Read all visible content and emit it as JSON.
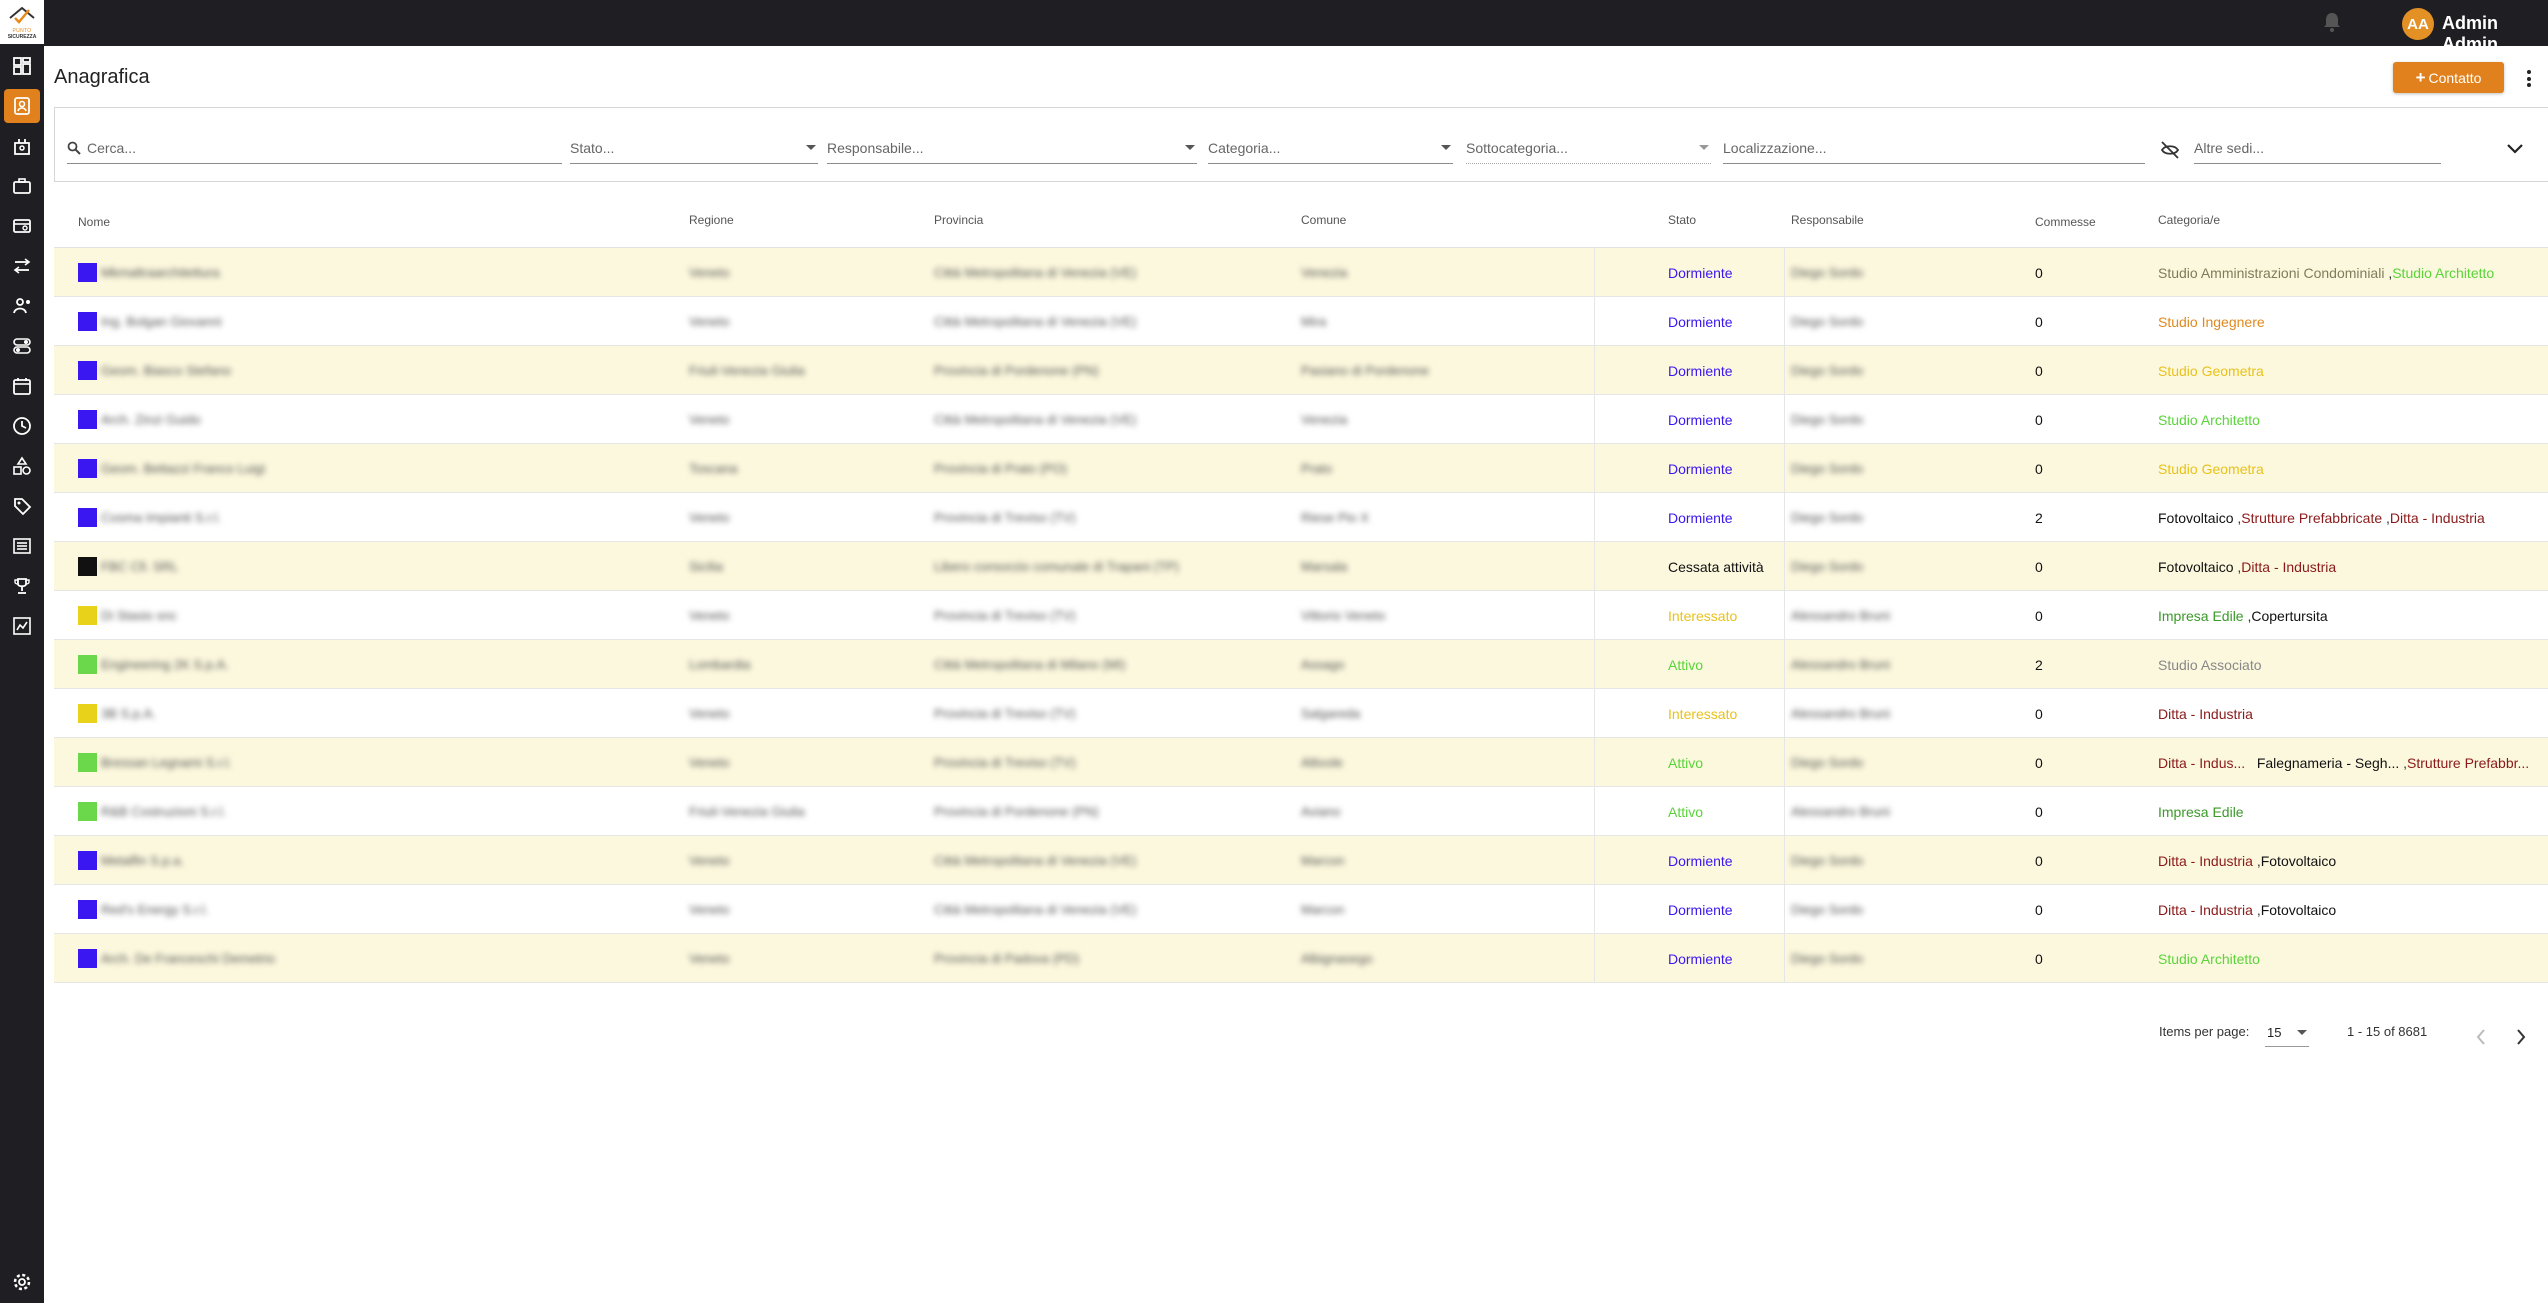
{
  "app": {
    "logo_text_1": "PUNTO",
    "logo_text_2": "SICUREZZA",
    "user_initials": "AA",
    "user_name": "Admin Admin"
  },
  "sidebar": {
    "items": [
      {
        "icon": "dashboard-icon",
        "active": false
      },
      {
        "icon": "contacts-icon",
        "active": true
      },
      {
        "icon": "company-icon",
        "active": false
      },
      {
        "icon": "briefcase-icon",
        "active": false
      },
      {
        "icon": "billing-icon",
        "active": false
      },
      {
        "icon": "transfer-icon",
        "active": false
      },
      {
        "icon": "user-manage-icon",
        "active": false
      },
      {
        "icon": "toggles-icon",
        "active": false
      },
      {
        "icon": "calendar-icon",
        "active": false
      },
      {
        "icon": "clock-icon",
        "active": false
      },
      {
        "icon": "shapes-icon",
        "active": false
      },
      {
        "icon": "tag-icon",
        "active": false
      },
      {
        "icon": "list-icon",
        "active": false
      },
      {
        "icon": "trophy-icon",
        "active": false
      },
      {
        "icon": "chart-icon",
        "active": false
      },
      {
        "icon": "settings-icon",
        "active": false
      }
    ]
  },
  "header": {
    "title": "Anagrafica",
    "add_label": "Contatto"
  },
  "filters": {
    "search_placeholder": "Cerca...",
    "stato_placeholder": "Stato...",
    "responsabile_placeholder": "Responsabile...",
    "categoria_placeholder": "Categoria...",
    "sottocategoria_placeholder": "Sottocategoria...",
    "localizzazione_placeholder": "Localizzazione...",
    "altre_sedi_placeholder": "Altre sedi..."
  },
  "table": {
    "columns": {
      "nome": "Nome",
      "regione": "Regione",
      "provincia": "Provincia",
      "comune": "Comune",
      "stato": "Stato",
      "responsabile": "Responsabile",
      "commesse": "Commesse",
      "categorie": "Categoria/e"
    },
    "rows": [
      {
        "color": "#3a16f0",
        "nome": "Mkmaltraarchitettura",
        "regione": "Veneto",
        "provincia": "Città Metropolitana di Venezia (VE)",
        "comune": "Venezia",
        "stato": "Dormiente",
        "stato_color": "#3a16f0",
        "responsabile": "Diego Sordo",
        "commesse": "0",
        "categorie": [
          {
            "t": "Studio Amministrazioni Condominiali",
            "c": "#7d7d5a"
          },
          {
            "t": " ,",
            "c": "#333"
          },
          {
            "t": "Studio Architetto",
            "c": "#5ad43a"
          }
        ]
      },
      {
        "color": "#3a16f0",
        "nome": "Ing. Bolgan Giovanni",
        "regione": "Veneto",
        "provincia": "Città Metropolitana di Venezia (VE)",
        "comune": "Mira",
        "stato": "Dormiente",
        "stato_color": "#3a16f0",
        "responsabile": "Diego Sordo",
        "commesse": "0",
        "categorie": [
          {
            "t": "Studio Ingegnere",
            "c": "#e08a1e"
          }
        ]
      },
      {
        "color": "#3a16f0",
        "nome": "Geom. Biasco Stefano",
        "regione": "Friuli-Venezia Giulia",
        "provincia": "Provincia di Pordenone (PN)",
        "comune": "Pasiano di Pordenone",
        "stato": "Dormiente",
        "stato_color": "#3a16f0",
        "responsabile": "Diego Sordo",
        "commesse": "0",
        "categorie": [
          {
            "t": "Studio Geometra",
            "c": "#e8c21a"
          }
        ]
      },
      {
        "color": "#3a16f0",
        "nome": "Arch. Zinzi Guido",
        "regione": "Veneto",
        "provincia": "Città Metropolitana di Venezia (VE)",
        "comune": "Venezia",
        "stato": "Dormiente",
        "stato_color": "#3a16f0",
        "responsabile": "Diego Sordo",
        "commesse": "0",
        "categorie": [
          {
            "t": "Studio Architetto",
            "c": "#5ad43a"
          }
        ]
      },
      {
        "color": "#3a16f0",
        "nome": "Geom. Bettazzi Franco Luigi",
        "regione": "Toscana",
        "provincia": "Provincia di Prato (PO)",
        "comune": "Prato",
        "stato": "Dormiente",
        "stato_color": "#3a16f0",
        "responsabile": "Diego Sordo",
        "commesse": "0",
        "categorie": [
          {
            "t": "Studio Geometra",
            "c": "#e8c21a"
          }
        ]
      },
      {
        "color": "#3a16f0",
        "nome": "Cosma Impianti S.r.l.",
        "regione": "Veneto",
        "provincia": "Provincia di Treviso (TV)",
        "comune": "Riese Pio X",
        "stato": "Dormiente",
        "stato_color": "#3a16f0",
        "responsabile": "Diego Sordo",
        "commesse": "2",
        "categorie": [
          {
            "t": "Fotovoltaico",
            "c": "#111"
          },
          {
            "t": " ,",
            "c": "#333"
          },
          {
            "t": "Strutture Prefabbricate",
            "c": "#8a1a1a"
          },
          {
            "t": " ,",
            "c": "#333"
          },
          {
            "t": "Ditta - Industria",
            "c": "#8a1a1a"
          }
        ]
      },
      {
        "color": "#111111",
        "nome": "FBC Cll. SRL",
        "regione": "Sicilia",
        "provincia": "Libero consorzio comunale di Trapani (TP)",
        "comune": "Marsala",
        "stato": "Cessata attività",
        "stato_color": "#111111",
        "responsabile": "Diego Sordo",
        "commesse": "0",
        "categorie": [
          {
            "t": "Fotovoltaico",
            "c": "#111"
          },
          {
            "t": " ,",
            "c": "#333"
          },
          {
            "t": "Ditta - Industria",
            "c": "#8a1a1a"
          }
        ]
      },
      {
        "color": "#e8d21a",
        "nome": "Di Stasio snc",
        "regione": "Veneto",
        "provincia": "Provincia di Treviso (TV)",
        "comune": "Vittorio Veneto",
        "stato": "Interessato",
        "stato_color": "#e8c21a",
        "responsabile": "Alessandro Bruni",
        "commesse": "0",
        "categorie": [
          {
            "t": "Impresa Edile",
            "c": "#3a9a2a"
          },
          {
            "t": " ,",
            "c": "#333"
          },
          {
            "t": "Copertursita",
            "c": "#111"
          }
        ]
      },
      {
        "color": "#6ad84a",
        "nome": "Engineering 2K S.p.A.",
        "regione": "Lombardia",
        "provincia": "Città Metropolitana di Milano (MI)",
        "comune": "Assago",
        "stato": "Attivo",
        "stato_color": "#5ad43a",
        "responsabile": "Alessandro Bruni",
        "commesse": "2",
        "categorie": [
          {
            "t": "Studio Associato",
            "c": "#888"
          }
        ]
      },
      {
        "color": "#e8d21a",
        "nome": "3B S.p.A.",
        "regione": "Veneto",
        "provincia": "Provincia di Treviso (TV)",
        "comune": "Salgareda",
        "stato": "Interessato",
        "stato_color": "#e8c21a",
        "responsabile": "Alessandro Bruni",
        "commesse": "0",
        "categorie": [
          {
            "t": "Ditta - Industria",
            "c": "#8a1a1a"
          }
        ]
      },
      {
        "color": "#6ad84a",
        "nome": "Bressan Legnami S.r.l.",
        "regione": "Veneto",
        "provincia": "Provincia di Treviso (TV)",
        "comune": "Altivole",
        "stato": "Attivo",
        "stato_color": "#5ad43a",
        "responsabile": "Diego Sordo",
        "commesse": "0",
        "categorie": [
          {
            "t": "Ditta - Indus...",
            "c": "#8a1a1a"
          },
          {
            "t": "   ",
            "c": "#333"
          },
          {
            "t": "Falegnameria - Segh...",
            "c": "#111"
          },
          {
            "t": " ,",
            "c": "#333"
          },
          {
            "t": "Strutture Prefabbr...",
            "c": "#8a1a1a"
          }
        ]
      },
      {
        "color": "#6ad84a",
        "nome": "R&B Costruzioni S.r.l.",
        "regione": "Friuli-Venezia Giulia",
        "provincia": "Provincia di Pordenone (PN)",
        "comune": "Aviano",
        "stato": "Attivo",
        "stato_color": "#5ad43a",
        "responsabile": "Alessandro Bruni",
        "commesse": "0",
        "categorie": [
          {
            "t": "Impresa Edile",
            "c": "#3a9a2a"
          }
        ]
      },
      {
        "color": "#3a16f0",
        "nome": "Metalfin S.p.a.",
        "regione": "Veneto",
        "provincia": "Città Metropolitana di Venezia (VE)",
        "comune": "Marcon",
        "stato": "Dormiente",
        "stato_color": "#3a16f0",
        "responsabile": "Diego Sordo",
        "commesse": "0",
        "categorie": [
          {
            "t": "Ditta - Industria",
            "c": "#8a1a1a"
          },
          {
            "t": " ,",
            "c": "#333"
          },
          {
            "t": "Fotovoltaico",
            "c": "#111"
          }
        ]
      },
      {
        "color": "#3a16f0",
        "nome": "Red's Energy S.r.l.",
        "regione": "Veneto",
        "provincia": "Città Metropolitana di Venezia (VE)",
        "comune": "Marcon",
        "stato": "Dormiente",
        "stato_color": "#3a16f0",
        "responsabile": "Diego Sordo",
        "commesse": "0",
        "categorie": [
          {
            "t": "Ditta - Industria",
            "c": "#8a1a1a"
          },
          {
            "t": " ,",
            "c": "#333"
          },
          {
            "t": "Fotovoltaico",
            "c": "#111"
          }
        ]
      },
      {
        "color": "#3a16f0",
        "nome": "Arch. De Franceschi Demetrio",
        "regione": "Veneto",
        "provincia": "Provincia di Padova (PD)",
        "comune": "Albignasego",
        "stato": "Dormiente",
        "stato_color": "#3a16f0",
        "responsabile": "Diego Sordo",
        "commesse": "0",
        "categorie": [
          {
            "t": "Studio Architetto",
            "c": "#5ad43a"
          }
        ]
      }
    ]
  },
  "pagination": {
    "items_per_page_label": "Items per page:",
    "items_per_page": "15",
    "range": "1 - 15 of 8681"
  }
}
